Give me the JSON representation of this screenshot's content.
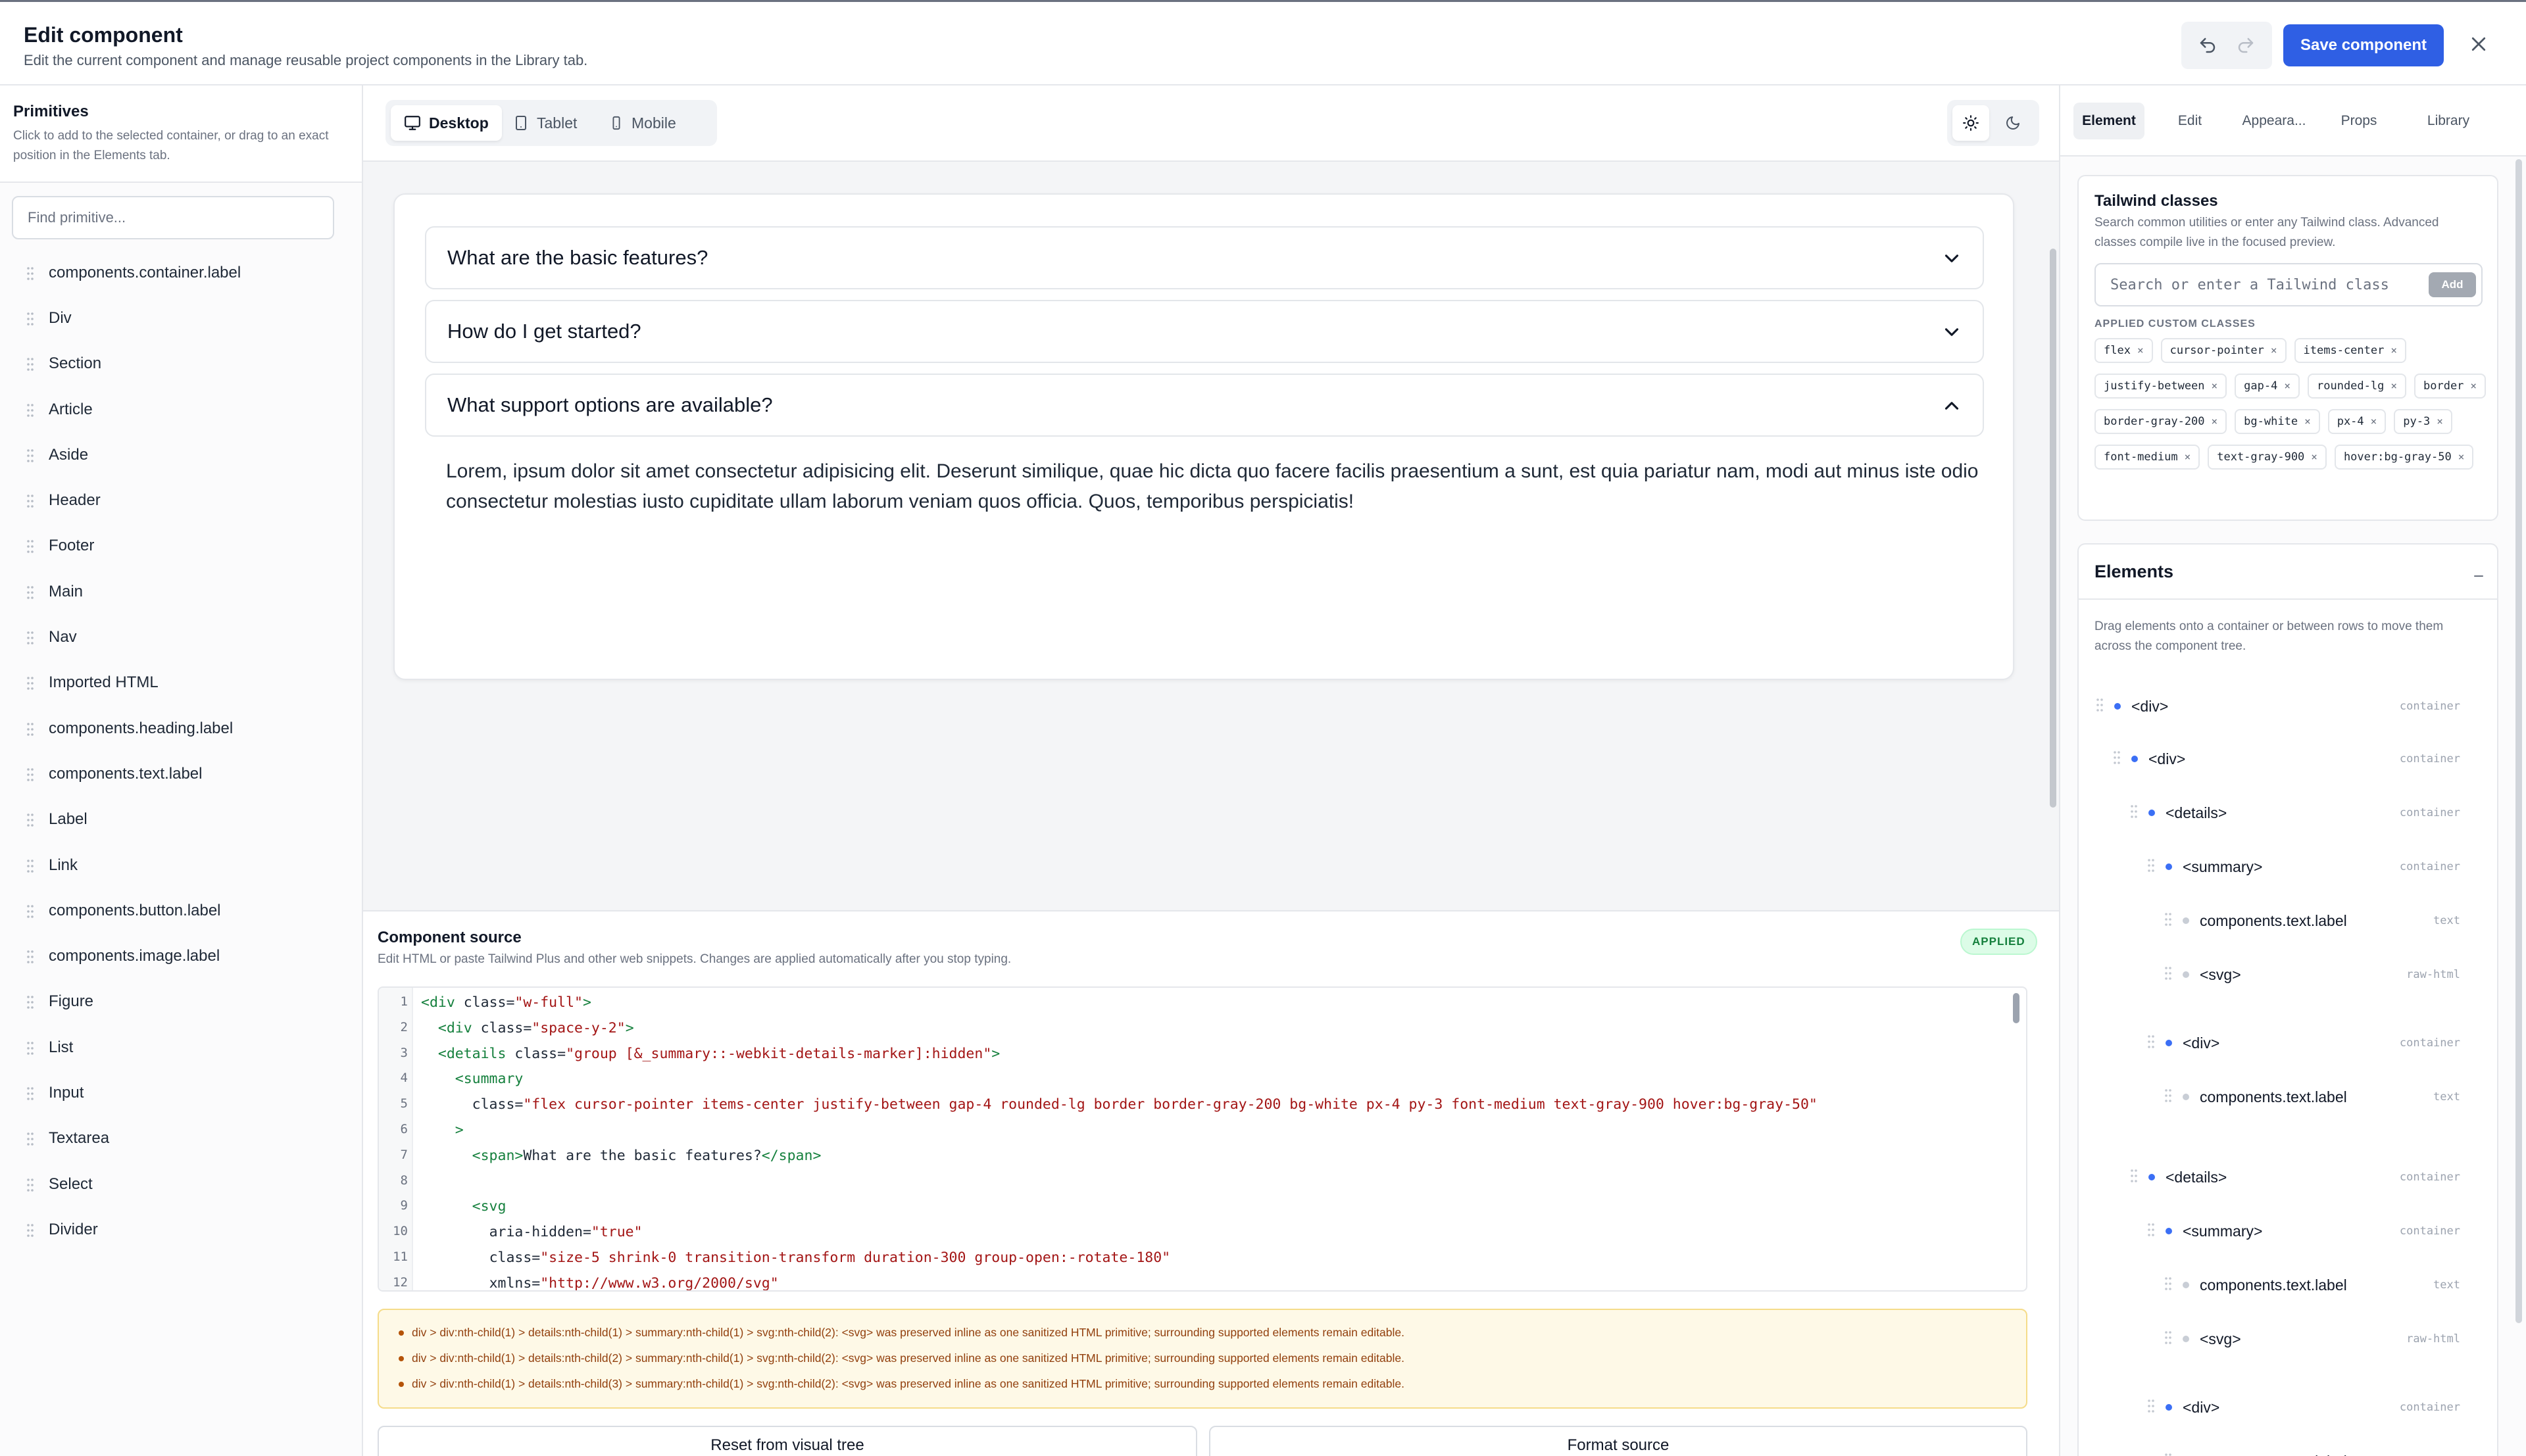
{
  "header": {
    "title": "Edit component",
    "subtitle": "Edit the current component and manage reusable project components in the Library tab.",
    "save_label": "Save component"
  },
  "primitives": {
    "title": "Primitives",
    "description": "Click to add to the selected container, or drag to an exact position in the Elements tab.",
    "search_placeholder": "Find primitive...",
    "items": [
      "components.container.label",
      "Div",
      "Section",
      "Article",
      "Aside",
      "Header",
      "Footer",
      "Main",
      "Nav",
      "Imported HTML",
      "components.heading.label",
      "components.text.label",
      "Label",
      "Link",
      "components.button.label",
      "components.image.label",
      "Figure",
      "List",
      "Input",
      "Textarea",
      "Select",
      "Divider"
    ]
  },
  "devices": {
    "tabs": [
      "Desktop",
      "Tablet",
      "Mobile"
    ],
    "active": "Desktop"
  },
  "preview": {
    "accordion": [
      {
        "question": "What are the basic features?",
        "open": false
      },
      {
        "question": "How do I get started?",
        "open": false
      },
      {
        "question": "What support options are available?",
        "open": true
      }
    ],
    "answer": "Lorem, ipsum dolor sit amet consectetur adipisicing elit. Deserunt similique, quae hic dicta quo facere facilis praesentium a sunt, est quia pariatur nam, modi aut minus iste odio consectetur molestias iusto cupiditate ullam laborum veniam quos officia. Quos, temporibus perspiciatis!"
  },
  "source": {
    "title": "Component source",
    "description": "Edit HTML or paste Tailwind Plus and other web snippets. Changes are applied automatically after you stop typing.",
    "status": "APPLIED",
    "lines": [
      [
        [
          "tag",
          "<div "
        ],
        [
          "attr",
          "class="
        ],
        [
          "str",
          "\"w-full\""
        ],
        [
          "tag",
          ">"
        ]
      ],
      [
        [
          "txt",
          "  "
        ],
        [
          "tag",
          "<div "
        ],
        [
          "attr",
          "class="
        ],
        [
          "str",
          "\"space-y-2\""
        ],
        [
          "tag",
          ">"
        ]
      ],
      [
        [
          "txt",
          "  "
        ],
        [
          "tag",
          "<details "
        ],
        [
          "attr",
          "class="
        ],
        [
          "str",
          "\"group [&_summary::-webkit-details-marker]:hidden\""
        ],
        [
          "tag",
          ">"
        ]
      ],
      [
        [
          "txt",
          "    "
        ],
        [
          "tag",
          "<summary"
        ]
      ],
      [
        [
          "txt",
          "      "
        ],
        [
          "attr",
          "class="
        ],
        [
          "str",
          "\"flex cursor-pointer items-center justify-between gap-4 rounded-lg border border-gray-200 bg-white px-4 py-3 font-medium text-gray-900 hover:bg-gray-50\""
        ]
      ],
      [
        [
          "txt",
          "    "
        ],
        [
          "tag",
          ">"
        ]
      ],
      [
        [
          "txt",
          "      "
        ],
        [
          "tag",
          "<span>"
        ],
        [
          "txt",
          "What are the basic features?"
        ],
        [
          "tag",
          "</span>"
        ]
      ],
      [],
      [
        [
          "txt",
          "      "
        ],
        [
          "tag",
          "<svg"
        ]
      ],
      [
        [
          "txt",
          "        "
        ],
        [
          "attr",
          "aria-hidden="
        ],
        [
          "str",
          "\"true\""
        ]
      ],
      [
        [
          "txt",
          "        "
        ],
        [
          "attr",
          "class="
        ],
        [
          "str",
          "\"size-5 shrink-0 transition-transform duration-300 group-open:-rotate-180\""
        ]
      ],
      [
        [
          "txt",
          "        "
        ],
        [
          "attr",
          "xmlns="
        ],
        [
          "str",
          "\"http://www.w3.org/2000/svg\""
        ]
      ]
    ],
    "warnings": [
      "div > div:nth-child(1) > details:nth-child(1) > summary:nth-child(1) > svg:nth-child(2): <svg> was preserved inline as one sanitized HTML primitive; surrounding supported elements remain editable.",
      "div > div:nth-child(1) > details:nth-child(2) > summary:nth-child(1) > svg:nth-child(2): <svg> was preserved inline as one sanitized HTML primitive; surrounding supported elements remain editable.",
      "div > div:nth-child(1) > details:nth-child(3) > summary:nth-child(1) > svg:nth-child(2): <svg> was preserved inline as one sanitized HTML primitive; surrounding supported elements remain editable."
    ],
    "reset_label": "Reset from visual tree",
    "format_label": "Format source"
  },
  "right_tabs": {
    "tabs": [
      "Element",
      "Edit",
      "Appeara...",
      "Props",
      "Library"
    ],
    "active": "Element"
  },
  "tailwind": {
    "title": "Tailwind classes",
    "description": "Search common utilities or enter any Tailwind class. Advanced classes compile live in the focused preview.",
    "placeholder": "Search or enter a Tailwind class",
    "add_label": "Add",
    "applied_title": "APPLIED CUSTOM CLASSES",
    "classes": [
      "flex",
      "cursor-pointer",
      "items-center",
      "justify-between",
      "gap-4",
      "rounded-lg",
      "border",
      "border-gray-200",
      "bg-white",
      "px-4",
      "py-3",
      "font-medium",
      "text-gray-900",
      "hover:bg-gray-50"
    ]
  },
  "elements": {
    "title": "Elements",
    "description": "Drag elements onto a container or between rows to move them across the component tree.",
    "tree": [
      {
        "label": "<div>",
        "type": "container",
        "depth": 0,
        "kind": "container"
      },
      {
        "label": "<div>",
        "type": "container",
        "depth": 1,
        "kind": "container"
      },
      {
        "label": "<details>",
        "type": "container",
        "depth": 2,
        "kind": "container"
      },
      {
        "label": "<summary>",
        "type": "container",
        "depth": 3,
        "kind": "container"
      },
      {
        "label": "components.text.label",
        "type": "text",
        "depth": 4,
        "kind": "leaf"
      },
      {
        "label": "<svg>",
        "type": "raw-html",
        "depth": 4,
        "kind": "leaf"
      },
      {
        "label": "<div>",
        "type": "container",
        "depth": 3,
        "kind": "container"
      },
      {
        "label": "components.text.label",
        "type": "text",
        "depth": 4,
        "kind": "leaf"
      },
      {
        "label": "<details>",
        "type": "container",
        "depth": 2,
        "kind": "container"
      },
      {
        "label": "<summary>",
        "type": "container",
        "depth": 3,
        "kind": "container"
      },
      {
        "label": "components.text.label",
        "type": "text",
        "depth": 4,
        "kind": "leaf"
      },
      {
        "label": "<svg>",
        "type": "raw-html",
        "depth": 4,
        "kind": "leaf"
      },
      {
        "label": "<div>",
        "type": "container",
        "depth": 3,
        "kind": "container"
      },
      {
        "label": "components.text.label",
        "type": "text",
        "depth": 4,
        "kind": "leaf"
      }
    ]
  },
  "colors": {
    "accent": "#2f5fe4",
    "success": "#15803d",
    "warning_bg": "#fef9e7",
    "warning_text": "#92400e",
    "node_dot": "#3b6ff5"
  },
  "icons": [
    "undo-icon",
    "redo-icon",
    "close-icon",
    "drag-handle-icon",
    "desktop-icon",
    "tablet-icon",
    "mobile-icon",
    "sun-icon",
    "moon-icon",
    "chevron-down-icon",
    "chevron-up-icon",
    "remove-icon",
    "minus-icon"
  ]
}
